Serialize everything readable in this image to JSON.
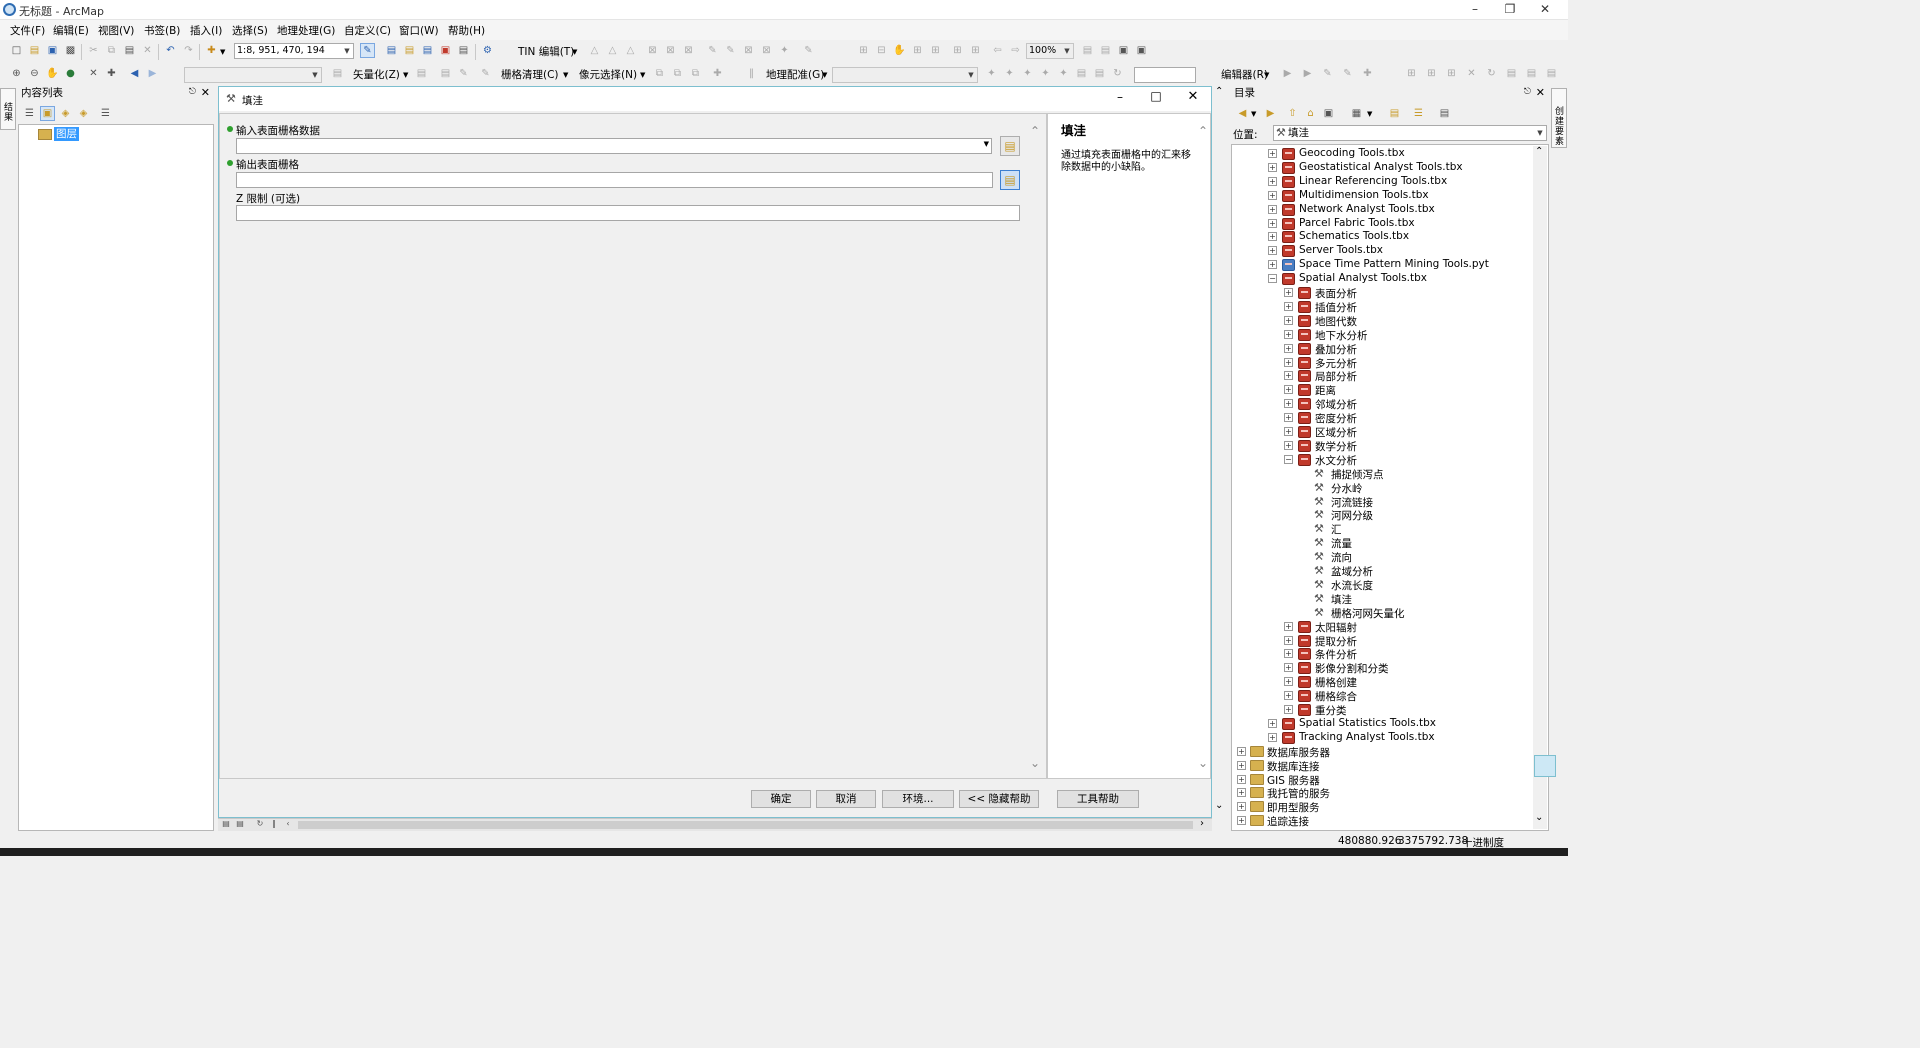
{
  "window": {
    "title": "无标题 - ArcMap"
  },
  "menu": [
    "文件(F)",
    "编辑(E)",
    "视图(V)",
    "书签(B)",
    "插入(I)",
    "选择(S)",
    "地理处理(G)",
    "自定义(C)",
    "窗口(W)",
    "帮助(H)"
  ],
  "toolbar": {
    "scale": "1:8, 951, 470, 194",
    "tin_edit": "TIN 编辑(T)",
    "zoom": "100%",
    "vectorize": "矢量化(Z)",
    "raster_cleanup": "栅格清理(C)",
    "cell_select": "像元选择(N)",
    "georef": "地理配准(G)",
    "editor": "编辑器(R)"
  },
  "toc": {
    "title": "内容列表",
    "root": "图层",
    "side_tab": "结果"
  },
  "dialog": {
    "title": "填洼",
    "field1_label": "输入表面栅格数据",
    "field2_label": "输出表面栅格",
    "field3_label": "Z 限制 (可选)",
    "field1_value": "",
    "field2_value": "",
    "field3_value": "",
    "ok": "确定",
    "cancel": "取消",
    "env": "环境...",
    "hide_help": "<< 隐藏帮助",
    "tool_help": "工具帮助",
    "help_title": "填洼",
    "help_text": "通过填充表面栅格中的汇来移除数据中的小缺陷。"
  },
  "catalog": {
    "title": "目录",
    "location_label": "位置:",
    "location_value": "填洼",
    "side_tab": "创建要素",
    "toolboxes": [
      "Geocoding Tools.tbx",
      "Geostatistical Analyst Tools.tbx",
      "Linear Referencing Tools.tbx",
      "Multidimension Tools.tbx",
      "Network Analyst Tools.tbx",
      "Parcel Fabric Tools.tbx",
      "Schematics Tools.tbx",
      "Server Tools.tbx",
      "Space Time Pattern Mining Tools.pyt",
      "Spatial Analyst Tools.tbx"
    ],
    "sa_sets_a": [
      "表面分析",
      "插值分析",
      "地图代数",
      "地下水分析",
      "叠加分析",
      "多元分析",
      "局部分析",
      "距离",
      "邻域分析",
      "密度分析",
      "区域分析",
      "数学分析",
      "水文分析"
    ],
    "hydro_tools": [
      "捕捉倾泻点",
      "分水岭",
      "河流链接",
      "河网分级",
      "汇",
      "流量",
      "流向",
      "盆域分析",
      "水流长度",
      "填洼",
      "栅格河网矢量化"
    ],
    "sa_sets_b": [
      "太阳辐射",
      "提取分析",
      "条件分析",
      "影像分割和分类",
      "栅格创建",
      "栅格综合",
      "重分类"
    ],
    "toolboxes_b": [
      "Spatial Statistics Tools.tbx",
      "Tracking Analyst Tools.tbx"
    ],
    "roots": [
      "数据库服务器",
      "数据库连接",
      "GIS 服务器",
      "我托管的服务",
      "即用型服务",
      "追踪连接"
    ]
  },
  "status": {
    "x": "480880.926",
    "y": "3375792.738",
    "units": "十进制度"
  },
  "colors": {
    "dialog_border": "#7dbfcf",
    "selected": "#3399ff",
    "toolbox_red": "#c0392b"
  }
}
